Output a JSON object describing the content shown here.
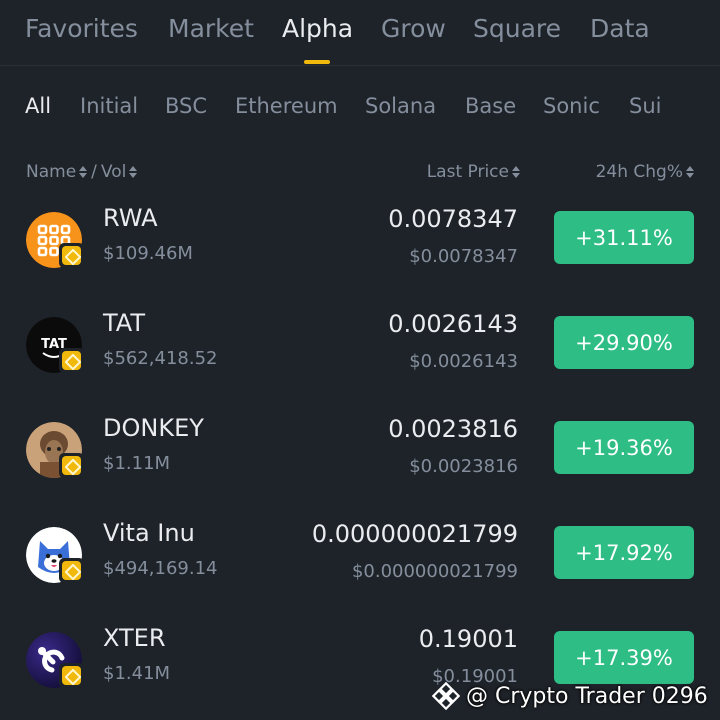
{
  "top_tabs": [
    "Favorites",
    "Market",
    "Alpha",
    "Grow",
    "Square",
    "Data"
  ],
  "active_top_tab": "Alpha",
  "chains": [
    "All",
    "Initial",
    "BSC",
    "Ethereum",
    "Solana",
    "Base",
    "Sonic",
    "Sui"
  ],
  "active_chain": "All",
  "header": {
    "name": "Name",
    "separator": "/",
    "vol": "Vol",
    "last_price": "Last Price",
    "change": "24h Chg%"
  },
  "rows": [
    {
      "symbol": "RWA",
      "volume": "$109.46M",
      "price": "0.0078347",
      "price_usd": "$0.0078347",
      "change": "+31.11%",
      "icon": "rwa-logo-icon"
    },
    {
      "symbol": "TAT",
      "volume": "$562,418.52",
      "price": "0.0026143",
      "price_usd": "$0.0026143",
      "change": "+29.90%",
      "icon": "tat-logo-icon"
    },
    {
      "symbol": "DONKEY",
      "volume": "$1.11M",
      "price": "0.0023816",
      "price_usd": "$0.0023816",
      "change": "+19.36%",
      "icon": "donkey-logo-icon"
    },
    {
      "symbol": "Vita Inu",
      "volume": "$494,169.14",
      "price": "0.000000021799",
      "price_usd": "$0.000000021799",
      "change": "+17.92%",
      "icon": "vita-inu-logo-icon"
    },
    {
      "symbol": "XTER",
      "volume": "$1.41M",
      "price": "0.19001",
      "price_usd": "$0.19001",
      "change": "+17.39%",
      "icon": "xter-logo-icon"
    }
  ],
  "watermark": "@ Crypto Trader 0296",
  "colors": {
    "background": "#1e2329",
    "accent": "#f0b90b",
    "positive": "#2ebd85",
    "muted_text": "#848e9c",
    "primary_text": "#eaecef"
  }
}
